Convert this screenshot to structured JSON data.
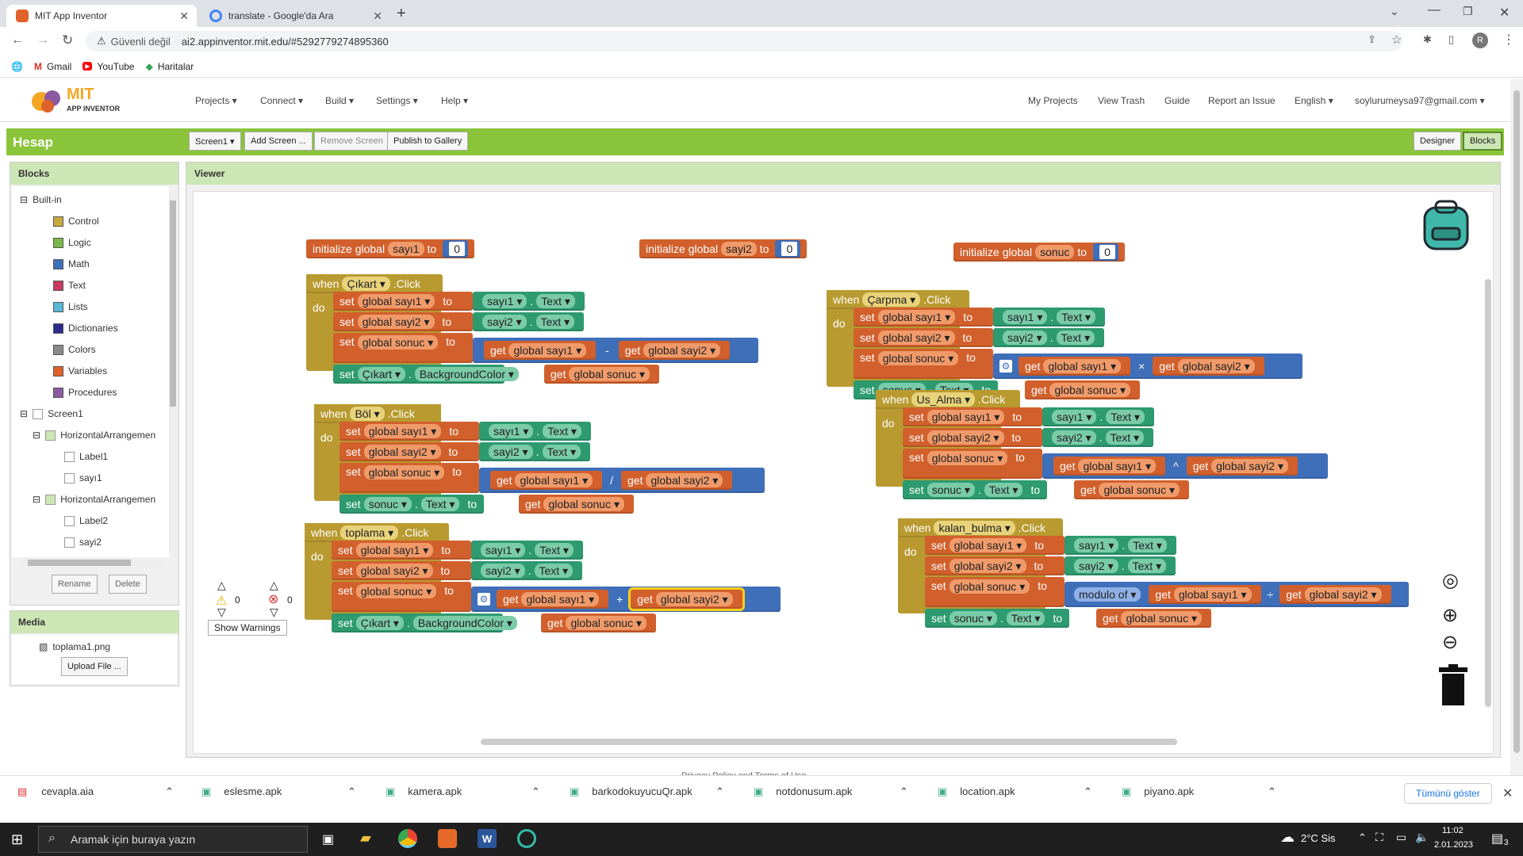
{
  "browser": {
    "tabs": [
      {
        "label": "MIT App Inventor"
      },
      {
        "label": "translate - Google'da Ara"
      }
    ],
    "new_tab": "+",
    "security_label": "Güvenli değil",
    "url": "ai2.appinventor.mit.edu/#5292779274895360",
    "bookmarks": [
      {
        "label": "Gmail"
      },
      {
        "label": "YouTube"
      },
      {
        "label": "Haritalar"
      }
    ],
    "profile_initial": "R"
  },
  "app": {
    "logo_line1": "MIT",
    "logo_line2": "APP INVENTOR",
    "menus": [
      "Projects ▾",
      "Connect ▾",
      "Build ▾",
      "Settings ▾",
      "Help ▾"
    ],
    "right_menus": [
      "My Projects",
      "View Trash",
      "Guide",
      "Report an Issue",
      "English ▾",
      "soylurumeysa97@gmail.com ▾"
    ],
    "project_name": "Hesap",
    "toolbar": {
      "screen": "Screen1 ▾",
      "add_screen": "Add Screen ...",
      "remove_screen": "Remove Screen",
      "publish": "Publish to Gallery",
      "designer": "Designer",
      "blocks": "Blocks"
    }
  },
  "blocks_panel": {
    "title": "Blocks",
    "builtin": "Built-in",
    "categories": [
      {
        "label": "Control",
        "color": "#c9a83f"
      },
      {
        "label": "Logic",
        "color": "#7ab648"
      },
      {
        "label": "Math",
        "color": "#3f6fb9"
      },
      {
        "label": "Text",
        "color": "#c9385e"
      },
      {
        "label": "Lists",
        "color": "#59b6d6"
      },
      {
        "label": "Dictionaries",
        "color": "#2d2a8e"
      },
      {
        "label": "Colors",
        "color": "#8a8a8a"
      },
      {
        "label": "Variables",
        "color": "#e0622a"
      },
      {
        "label": "Procedures",
        "color": "#8c5aa0"
      }
    ],
    "screen": "Screen1",
    "components": [
      {
        "label": "HorizontalArrangemen"
      },
      {
        "label": "Label1"
      },
      {
        "label": "sayı1"
      },
      {
        "label": "HorizontalArrangemen"
      },
      {
        "label": "Label2"
      },
      {
        "label": "sayi2"
      }
    ],
    "rename": "Rename",
    "delete": "Delete"
  },
  "media_panel": {
    "title": "Media",
    "file": "toplama1.png",
    "upload": "Upload File ..."
  },
  "viewer": {
    "title": "Viewer",
    "warnings_count": "0",
    "errors_count": "0",
    "show_warnings": "Show Warnings",
    "footer": "Privacy Policy and Terms of Use"
  },
  "code": {
    "init1": {
      "kw": "initialize global",
      "name": "sayı1",
      "to": "to",
      "value": "0"
    },
    "init2": {
      "kw": "initialize global",
      "name": "sayi2",
      "to": "to",
      "value": "0"
    },
    "init3": {
      "kw": "initialize global",
      "name": "sonuc",
      "to": "to",
      "value": "0"
    },
    "cikart": {
      "when": "when",
      "comp": "Çıkart ▾",
      "event": ".Click",
      "do": "do",
      "op": "-"
    },
    "bol": {
      "when": "when",
      "comp": "Böl ▾",
      "event": ".Click",
      "do": "do",
      "op": "/"
    },
    "toplama": {
      "when": "when",
      "comp": "toplama ▾",
      "event": ".Click",
      "do": "do",
      "op": "+"
    },
    "carpma": {
      "when": "when",
      "comp": "Çarpma ▾",
      "event": ".Click",
      "do": "do",
      "op": "×"
    },
    "usalma": {
      "when": "when",
      "comp": "Us_Alma ▾",
      "event": ".Click",
      "do": "do",
      "op": "^"
    },
    "kalan": {
      "when": "when",
      "comp": "kalan_bulma ▾",
      "event": ".Click",
      "do": "do",
      "op": "÷",
      "modulo": "modulo of ▾"
    },
    "words": {
      "set": "set",
      "to": "to",
      "get": "get",
      "dot": ".",
      "gsayi1": "global sayı1 ▾",
      "gsayi2": "global sayi2 ▾",
      "gsonuc": "global sonuc ▾",
      "sayi1": "sayı1 ▾",
      "sayi2": "sayi2 ▾",
      "sonuc": "sonuc ▾",
      "text": "Text ▾",
      "cikart": "Çıkart ▾",
      "bgcolor": "BackgroundColor ▾"
    }
  },
  "downloads": [
    {
      "label": "cevapla.aia"
    },
    {
      "label": "eslesme.apk"
    },
    {
      "label": "kamera.apk"
    },
    {
      "label": "barkodokuyucuQr.apk"
    },
    {
      "label": "notdonusum.apk"
    },
    {
      "label": "location.apk"
    },
    {
      "label": "piyano.apk"
    }
  ],
  "show_all": "Tümünü göster",
  "taskbar": {
    "search_placeholder": "Aramak için buraya yazın",
    "weather": "2°C  Sis",
    "time": "11:02",
    "date": "2.01.2023",
    "notif_count": "3"
  }
}
